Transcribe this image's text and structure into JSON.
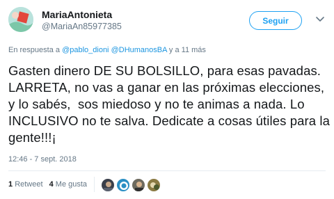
{
  "user": {
    "display_name": "MariaAntonieta",
    "handle": "@MariaAn85977385"
  },
  "follow_button": {
    "label": "Seguir"
  },
  "reply_context": {
    "prefix": "En respuesta a",
    "mention_1": "@pablo_dioni",
    "mention_2": "@DHumanosBA",
    "suffix": "y a 11 más"
  },
  "tweet": {
    "text": "Gasten dinero DE SU BOLSILLO, para esas pavadas. LARRETA, no vas a ganar en las próximas elecciones, y lo sabés,  sos miedoso y no te animas a nada. Lo INCLUSIVO no te salva. Dedicate a cosas útiles para la gente!!!¡",
    "timestamp": "12:46 - 7 sept. 2018"
  },
  "stats": {
    "retweet_count": "1",
    "retweet_label": "Retweet",
    "like_count": "4",
    "like_label": "Me gusta"
  },
  "colors": {
    "accent": "#1da1f2",
    "link": "#1b95e0",
    "muted": "#657786"
  }
}
